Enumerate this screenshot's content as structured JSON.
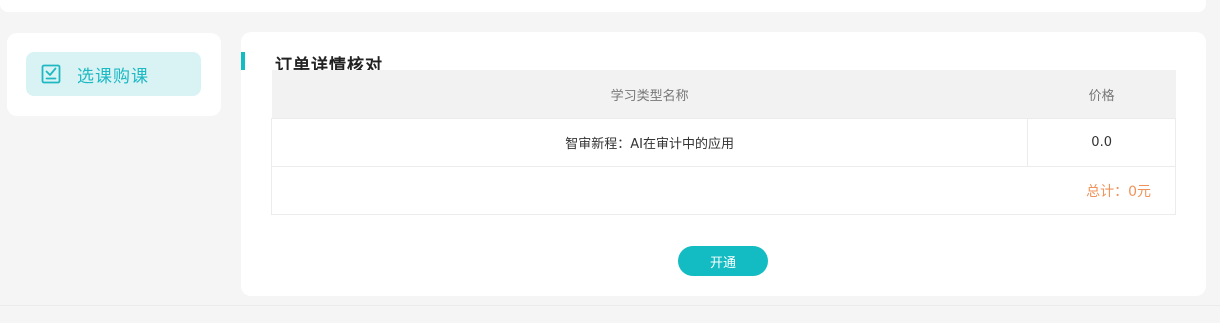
{
  "sidebar": {
    "items": [
      {
        "label": "选课购课",
        "icon": "checkbox-icon",
        "active": true
      }
    ]
  },
  "order": {
    "title": "订单详情核对",
    "columns": [
      "学习类型名称",
      "价格"
    ],
    "rows": [
      {
        "name": "智审新程：AI在审计中的应用",
        "price": "0.0"
      }
    ],
    "total": "总计：0元"
  },
  "actions": {
    "open_label": "开通"
  },
  "colors": {
    "accent": "#13bcc2",
    "sidebar_active_bg": "#d9f3f5",
    "total_text": "#f0935a"
  }
}
